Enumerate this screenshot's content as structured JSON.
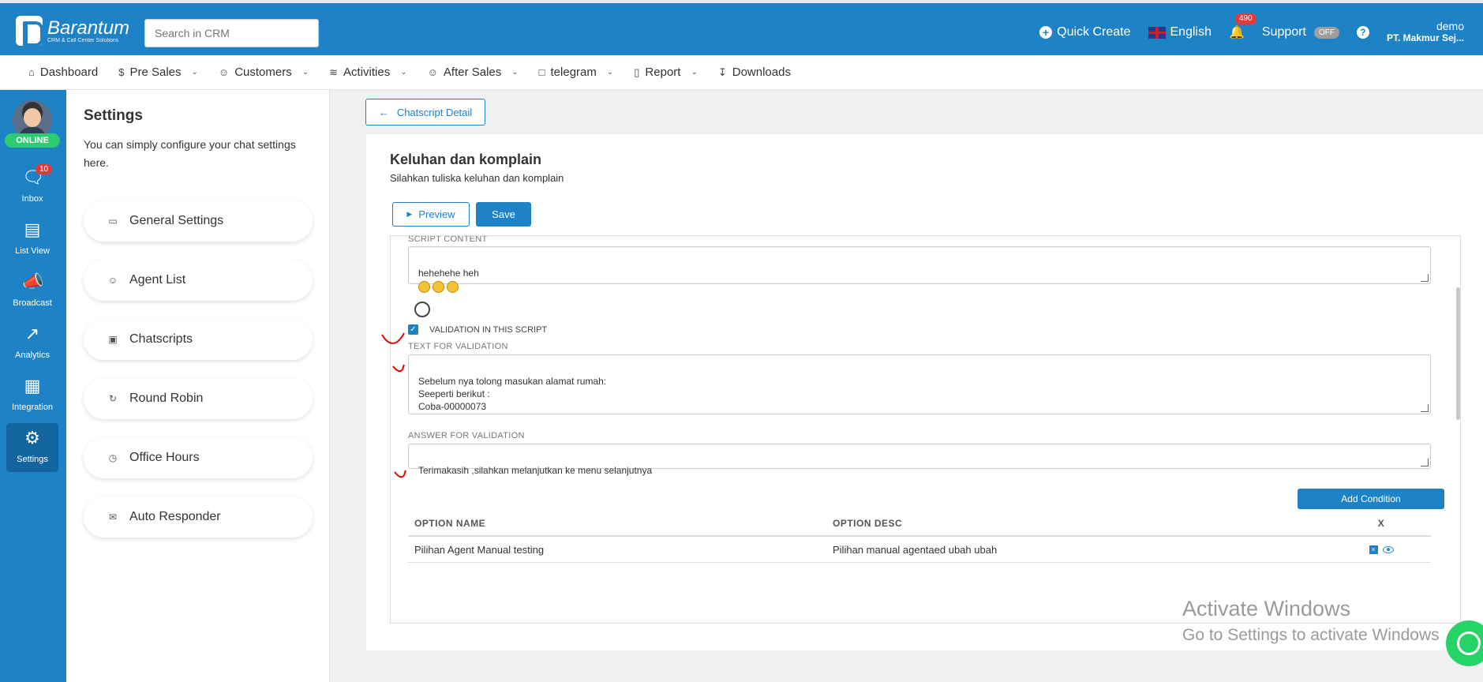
{
  "brand": {
    "name": "Barantum",
    "tagline": "CRM & Call Center Solutions"
  },
  "search": {
    "placeholder": "Search in CRM"
  },
  "header": {
    "quick_create": "Quick Create",
    "language": "English",
    "notifications_count": "490",
    "support": "Support",
    "support_toggle": "OFF",
    "help": "?",
    "user_name": "demo",
    "user_company": "PT. Makmur Sej..."
  },
  "nav": {
    "items": [
      {
        "label": "Dashboard",
        "icon": "home-icon"
      },
      {
        "label": "Pre Sales",
        "icon": "dollar-icon"
      },
      {
        "label": "Customers",
        "icon": "users-icon"
      },
      {
        "label": "Activities",
        "icon": "activity-icon"
      },
      {
        "label": "After Sales",
        "icon": "users-icon"
      },
      {
        "label": "telegram",
        "icon": "folder-icon"
      },
      {
        "label": "Report",
        "icon": "bar-chart-icon"
      },
      {
        "label": "Downloads",
        "icon": "download-icon"
      }
    ]
  },
  "sidebar": {
    "status": "ONLINE",
    "inbox_badge": "10",
    "items": [
      {
        "label": "Inbox",
        "icon": "chat-icon"
      },
      {
        "label": "List View",
        "icon": "list-icon"
      },
      {
        "label": "Broadcast",
        "icon": "megaphone-icon"
      },
      {
        "label": "Analytics",
        "icon": "line-chart-icon"
      },
      {
        "label": "Integration",
        "icon": "grid-icon"
      },
      {
        "label": "Settings",
        "icon": "gear-icon"
      }
    ]
  },
  "settings": {
    "title": "Settings",
    "description": "You can simply configure your chat settings here.",
    "menu": [
      {
        "label": "General Settings",
        "icon": "chat-bubbles-icon"
      },
      {
        "label": "Agent List",
        "icon": "users-icon"
      },
      {
        "label": "Chatscripts",
        "icon": "robot-icon"
      },
      {
        "label": "Round Robin",
        "icon": "refresh-icon"
      },
      {
        "label": "Office Hours",
        "icon": "clock-icon"
      },
      {
        "label": "Auto Responder",
        "icon": "envelope-icon"
      }
    ]
  },
  "main": {
    "back_label": "Chatscript Detail",
    "title": "Keluhan dan komplain",
    "subtitle": "Silahkan tuliska keluhan dan komplain",
    "preview_label": "Preview",
    "save_label": "Save",
    "script_content_label": "SCRIPT CONTENT",
    "script_content_value": "hehehehe heh",
    "validation_checkbox_label": "VALIDATION IN THIS SCRIPT",
    "validation_checked": true,
    "text_validation_label": "TEXT FOR VALIDATION",
    "text_validation_value": "Sebelum nya tolong masukan alamat rumah:\nSeeperti berikut :\nCoba-00000073",
    "answer_validation_label": "ANSWER FOR VALIDATION",
    "answer_validation_value": "Terimakasih ,silahkan melanjutkan ke menu selanjutnya",
    "add_condition_label": "Add Condition",
    "table": {
      "headers": [
        "OPTION NAME",
        "OPTION DESC",
        "X"
      ],
      "rows": [
        [
          "Pilihan Agent Manual testing",
          "Pilihan manual agentaed ubah ubah"
        ]
      ]
    }
  },
  "overlay": {
    "watermark_line1": "Activate Windows",
    "watermark_line2": "Go to Settings to activate Windows"
  },
  "colors": {
    "primary": "#1e82c6",
    "online": "#2ecc71",
    "badge": "#e53935"
  }
}
